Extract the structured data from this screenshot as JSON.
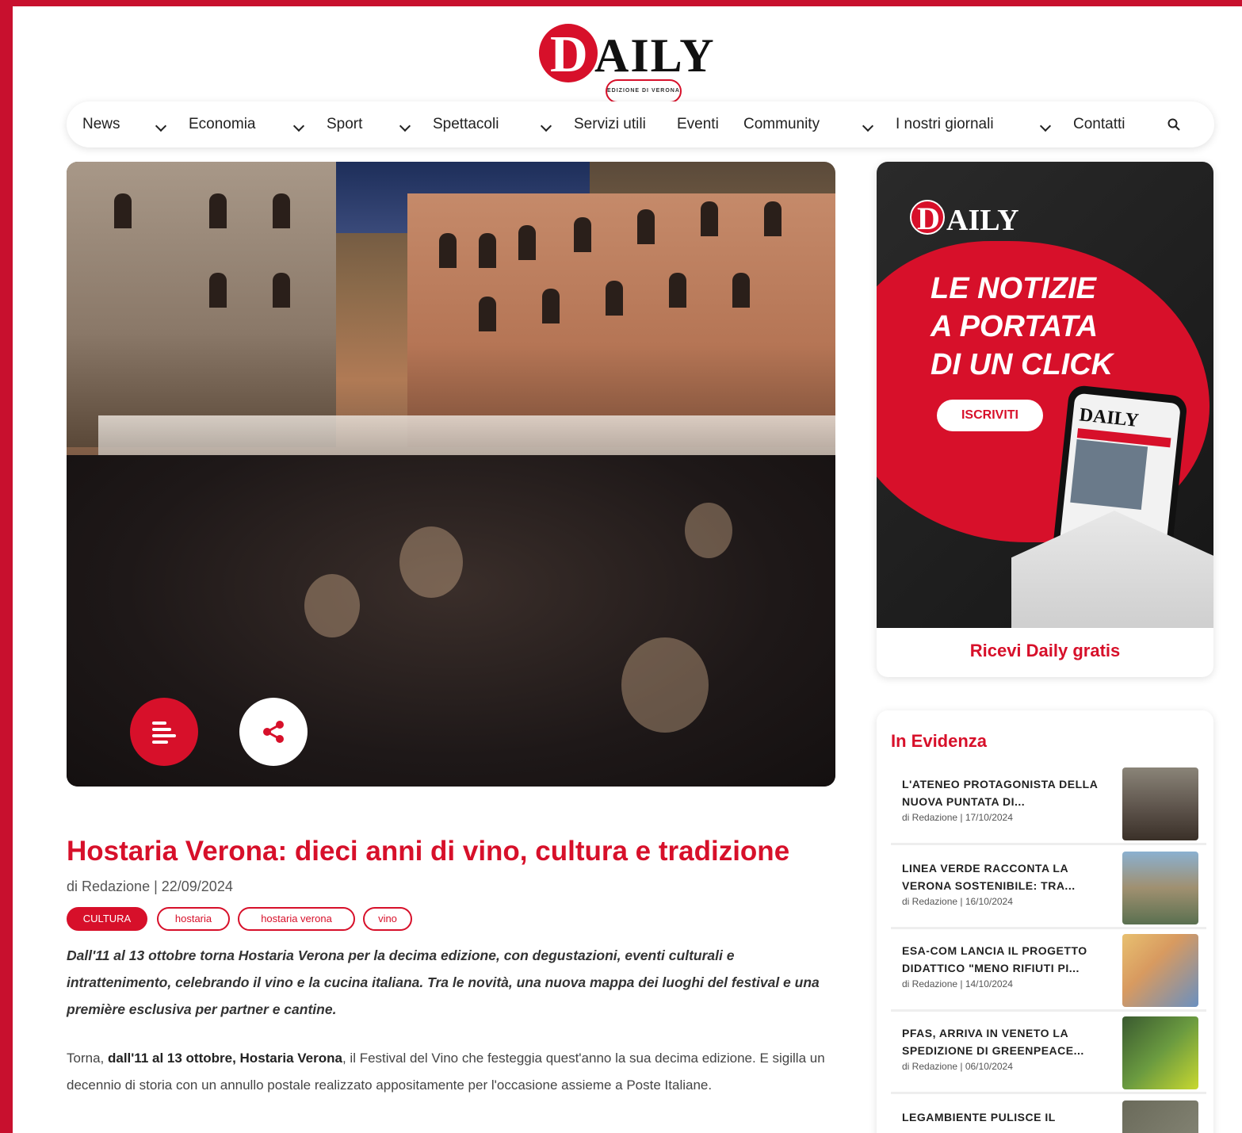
{
  "logo": {
    "initial": "D",
    "rest": "AILY",
    "tagline": "EDIZIONE DI VERONA"
  },
  "nav": {
    "items": [
      {
        "label": "News",
        "dropdown": true
      },
      {
        "label": "Economia",
        "dropdown": true
      },
      {
        "label": "Sport",
        "dropdown": true
      },
      {
        "label": "Spettacoli",
        "dropdown": true
      },
      {
        "label": "Servizi utili",
        "dropdown": false
      },
      {
        "label": "Eventi",
        "dropdown": false
      },
      {
        "label": "Community",
        "dropdown": true
      },
      {
        "label": "I nostri giornali",
        "dropdown": true
      },
      {
        "label": "Contatti",
        "dropdown": false
      }
    ],
    "search_icon": "search-icon"
  },
  "hero": {
    "list_icon": "list-icon",
    "share_icon": "share-icon"
  },
  "ad": {
    "logo_initial": "D",
    "logo_rest": "AILY",
    "headline_lines": [
      "LE NOTIZIE",
      "A PORTATA",
      "DI UN CLICK"
    ],
    "cta": "ISCRIVITI",
    "link": "Ricevi Daily gratis",
    "phone_logo": "DAILY"
  },
  "evidenza": {
    "heading": "In Evidenza",
    "items": [
      {
        "title": "L'ATENEO PROTAGONISTA DELLA NUOVA PUNTATA DI...",
        "meta": "di Redazione | 17/10/2024"
      },
      {
        "title": "LINEA VERDE RACCONTA LA VERONA SOSTENIBILE: TRA...",
        "meta": "di Redazione | 16/10/2024"
      },
      {
        "title": "ESA-COM LANCIA IL PROGETTO DIDATTICO \"MENO RIFIUTI PI...",
        "meta": "di Redazione | 14/10/2024"
      },
      {
        "title": "PFAS, ARRIVA IN VENETO LA SPEDIZIONE DI GREENPEACE...",
        "meta": "di Redazione | 06/10/2024"
      },
      {
        "title": "LEGAMBIENTE PULISCE IL",
        "meta": ""
      }
    ]
  },
  "article": {
    "title": "Hostaria Verona: dieci anni di vino, cultura e tradizione",
    "byline": "di Redazione | 22/09/2024",
    "tags": [
      "CULTURA",
      "hostaria",
      "hostaria verona",
      "vino"
    ],
    "lead": "Dall'11 al 13 ottobre torna Hostaria Verona per la decima edizione, con degustazioni, eventi culturali e intrattenimento, celebrando il vino e la cucina italiana. Tra le novità, una nuova mappa dei luoghi del festival e una première esclusiva per partner e cantine.",
    "body": {
      "t1": "Torna, ",
      "b1": "dall'11 al 13 ottobre, Hostaria Verona",
      "t2": ", il Festival del Vino che festeggia quest'anno la sua decima edizione. E sigilla un decennio di storia con un annullo postale realizzato appositamente per l'occasione assieme a Poste Italiane."
    }
  },
  "colors": {
    "accent": "#d7102a",
    "frame": "#c8102e"
  }
}
